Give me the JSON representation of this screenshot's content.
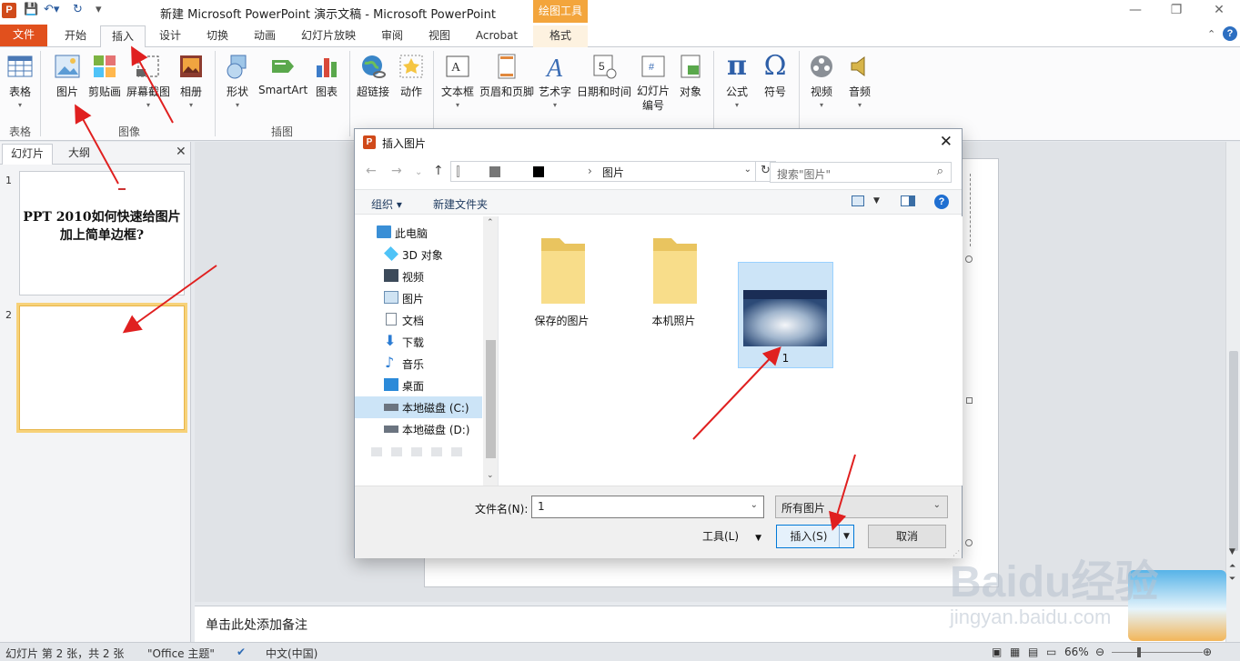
{
  "titlebar": {
    "title": "新建 Microsoft PowerPoint 演示文稿 - Microsoft PowerPoint",
    "context_tools": "绘图工具",
    "app_icon": "P"
  },
  "tabs": [
    "文件",
    "开始",
    "插入",
    "设计",
    "切换",
    "动画",
    "幻灯片放映",
    "审阅",
    "视图",
    "Acrobat",
    "格式"
  ],
  "ribbon": {
    "buttons": [
      "表格",
      "图片",
      "剪贴画",
      "屏幕截图",
      "相册",
      "形状",
      "SmartArt",
      "图表",
      "超链接",
      "动作",
      "文本框",
      "页眉和页脚",
      "艺术字",
      "日期和时间",
      "幻灯片编号",
      "对象",
      "公式",
      "符号",
      "视频",
      "音频"
    ],
    "groups": [
      "表格",
      "图像",
      "插图"
    ]
  },
  "left_panel": {
    "tabs": [
      "幻灯片",
      "大纲"
    ],
    "slides": [
      {
        "num": "1",
        "title": "PPT 2010如何快速给图片加上简单边框?"
      },
      {
        "num": "2",
        "title": ""
      }
    ]
  },
  "notes_placeholder": "单击此处添加备注",
  "status": {
    "slide_info": "幻灯片 第 2 张，共 2 张",
    "theme": "\"Office 主题\"",
    "language": "中文(中国)",
    "zoom": "66%"
  },
  "dialog": {
    "title": "插入图片",
    "breadcrumb": "图片",
    "search_placeholder": "搜索\"图片\"",
    "organize": "组织 ▾",
    "new_folder": "新建文件夹",
    "help": "?",
    "nav_items": [
      "此电脑",
      "3D 对象",
      "视频",
      "图片",
      "文档",
      "下载",
      "音乐",
      "桌面",
      "本地磁盘 (C:)",
      "本地磁盘 (D:)"
    ],
    "files": [
      "保存的图片",
      "本机照片",
      "1"
    ],
    "filename_label": "文件名(N):",
    "filename_value": "1",
    "filter": "所有图片",
    "tools": "工具(L)",
    "insert": "插入(S)",
    "cancel": "取消"
  },
  "watermark": {
    "brand": "Baidu经验",
    "url": "jingyan.baidu.com"
  }
}
